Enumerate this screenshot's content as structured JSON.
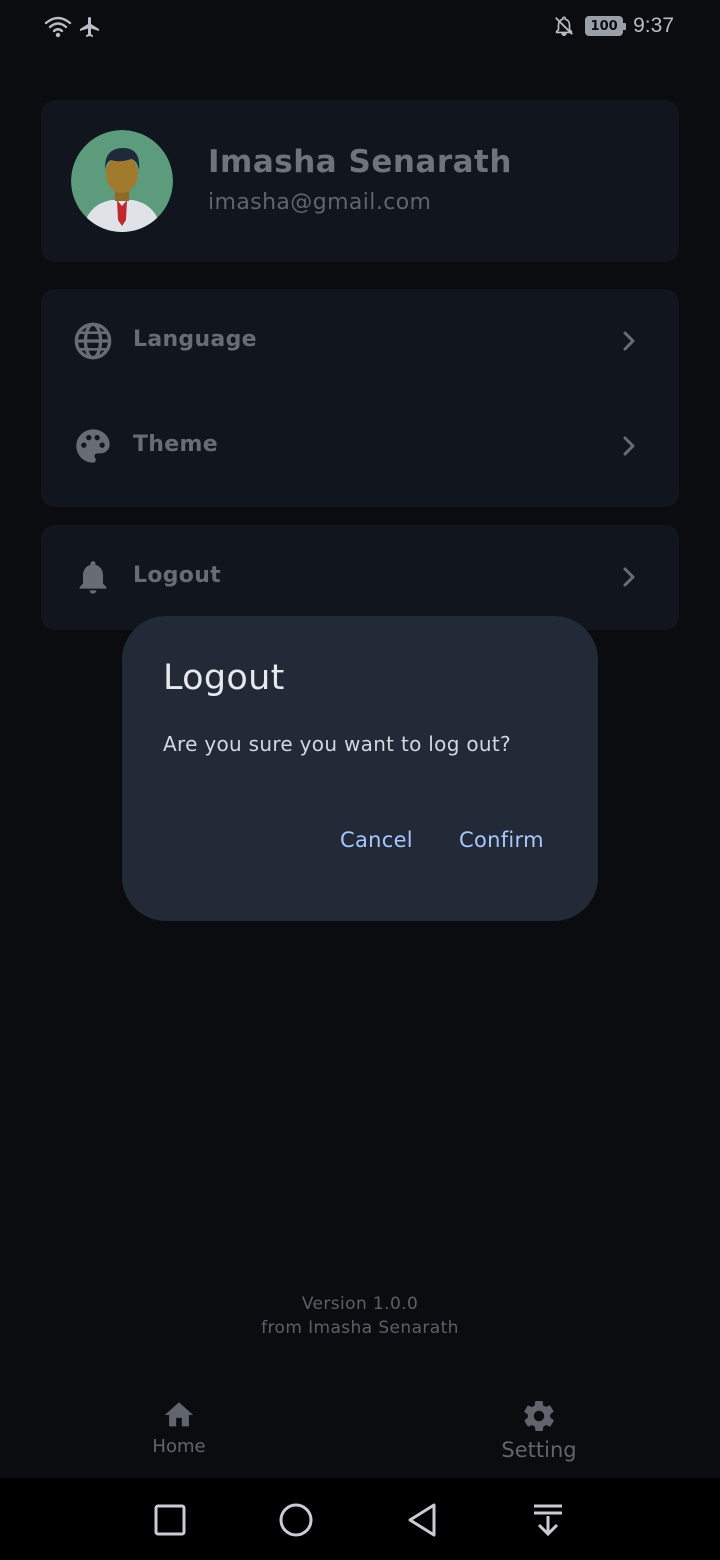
{
  "status_bar": {
    "icons": [
      "wifi-icon",
      "airplane-icon",
      "bell-off-icon",
      "battery-icon"
    ],
    "battery": "100",
    "time": "9:37"
  },
  "profile": {
    "name": "Imasha Senarath",
    "email": "imasha@gmail.com"
  },
  "settings": {
    "items": [
      {
        "label": "Language",
        "icon": "globe-icon"
      },
      {
        "label": "Theme",
        "icon": "palette-icon"
      }
    ]
  },
  "logout_row": {
    "label": "Logout",
    "icon": "bell-icon"
  },
  "footer": {
    "version": "Version 1.0.0",
    "from": "from Imasha Senarath"
  },
  "bottom_nav": {
    "items": [
      {
        "label": "Home",
        "icon": "home-icon"
      },
      {
        "label": "Setting",
        "icon": "gear-icon"
      }
    ]
  },
  "dialog": {
    "title": "Logout",
    "message": "Are you sure you want to log out?",
    "cancel_label": "Cancel",
    "confirm_label": "Confirm"
  },
  "colors": {
    "background": "#0b0c0f",
    "card": "#11151d",
    "dialog": "#222937",
    "accent": "#a9c7ff"
  }
}
